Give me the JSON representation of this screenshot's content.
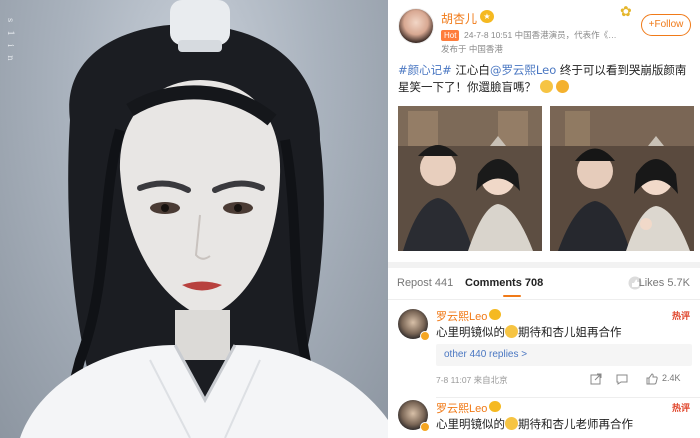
{
  "poster": {
    "alt": "",
    "watermark": "s 1 i n"
  },
  "post": {
    "author": "胡杏儿",
    "hot_badge": "Hot",
    "meta": "24-7-8 10:51  中国香港演员，代表作《…",
    "location": "发布于 中国香港",
    "follow_label": "+Follow",
    "hashtag": "#颜心记#",
    "text_1": " 江心白",
    "mention": "@罗云熙Leo",
    "text_2": " 终于可以看到哭崩版颜南星笑一下了！你還臉盲嗎？",
    "images_count": 2
  },
  "tabs": {
    "repost": "Repost 441",
    "comments": "Comments 708",
    "likes": "Likes 5.7K"
  },
  "comments": [
    {
      "name": "罗云熙Leo",
      "text_before": "心里明镜似的",
      "text_after": "期待和杏儿姐再合作",
      "hot": "热评",
      "replies": "other 440 replies >",
      "time": "7-8 11:07  来自北京",
      "likes": "2.4K"
    },
    {
      "name": "罗云熙Leo",
      "text_before": "心里明镜似的",
      "text_after": "期待和杏儿老师再合作",
      "hot": "热评"
    }
  ],
  "icons": {
    "share": "share-icon",
    "comment": "comment-icon",
    "like": "thumbs-up-icon"
  },
  "colors": {
    "accent": "#f07a18",
    "link": "#4a77c2",
    "hot": "#e0462c"
  }
}
